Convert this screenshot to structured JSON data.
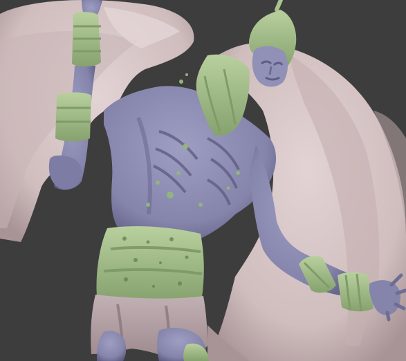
{
  "viewport": {
    "background": "#3d3d3d"
  },
  "materials": {
    "wing": "#d4c2c3",
    "wing_shadow": "#a89496",
    "body": "#8d8cb2",
    "body_shadow": "#5e5c82",
    "cloth": "#a9c48e",
    "cloth_shadow": "#6f8a5a",
    "skirt": "#b6a4a8",
    "skirt_shadow": "#857177"
  }
}
